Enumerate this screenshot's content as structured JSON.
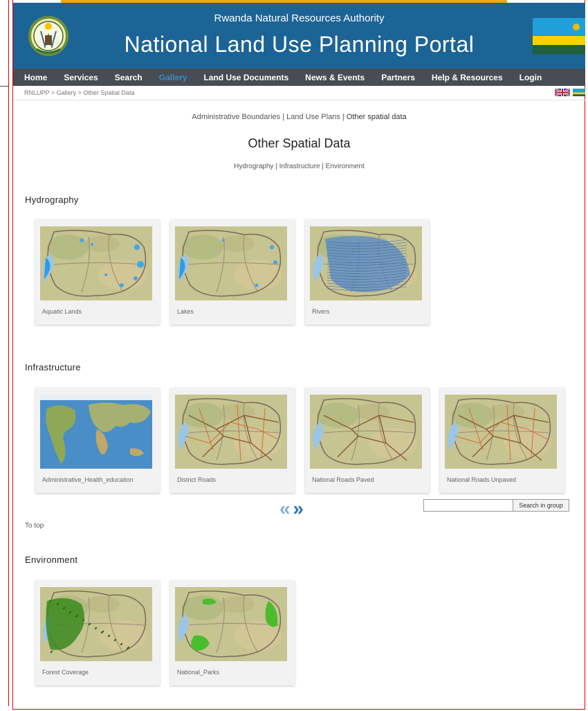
{
  "header": {
    "org_name": "Rwanda Natural Resources Authority",
    "portal_title": "National Land Use Planning Portal"
  },
  "nav": [
    {
      "label": "Home",
      "active": false
    },
    {
      "label": "Services",
      "active": false
    },
    {
      "label": "Search",
      "active": false
    },
    {
      "label": "Gallery",
      "active": true
    },
    {
      "label": "Land Use Documents",
      "active": false
    },
    {
      "label": "News & Events",
      "active": false
    },
    {
      "label": "Partners",
      "active": false
    },
    {
      "label": "Help & Resources",
      "active": false
    },
    {
      "label": "Login",
      "active": false
    }
  ],
  "breadcrumb": [
    "RNLUPP",
    "Gallery",
    "Other Spatial Data"
  ],
  "gallery_links": [
    "Administrative Boundaries",
    "Land Use Plans",
    "Other spatial data"
  ],
  "page_title": "Other Spatial Data",
  "section_links": [
    "Hydrography",
    "Infrastructure",
    "Environment"
  ],
  "sections": {
    "hydrography": {
      "title": "Hydrography",
      "items": [
        {
          "caption": "Aquatic Lands",
          "map": "aquatic"
        },
        {
          "caption": "Lakes",
          "map": "lakes"
        },
        {
          "caption": "Rivers",
          "map": "rivers"
        }
      ]
    },
    "infrastructure": {
      "title": "Infrastructure",
      "items": [
        {
          "caption": "Administrative_Health_education",
          "map": "world"
        },
        {
          "caption": "District Roads",
          "map": "roads-dense"
        },
        {
          "caption": "National Roads Paved",
          "map": "roads-paved"
        },
        {
          "caption": "National Roads Unpaved",
          "map": "roads-unpaved"
        }
      ]
    },
    "environment": {
      "title": "Environment",
      "items": [
        {
          "caption": "Forest Coverage",
          "map": "forest"
        },
        {
          "caption": "National_Parks",
          "map": "parks"
        }
      ]
    }
  },
  "pager": {
    "prev": "«",
    "next": "»"
  },
  "search": {
    "button": "Search in group",
    "value": ""
  },
  "to_top": "To top",
  "colors": {
    "header_bg": "#1d6496",
    "nav_bg": "#484c54",
    "nav_active": "#3a8cc4",
    "accent_strip": "#f2a900",
    "frame": "#d40000"
  }
}
